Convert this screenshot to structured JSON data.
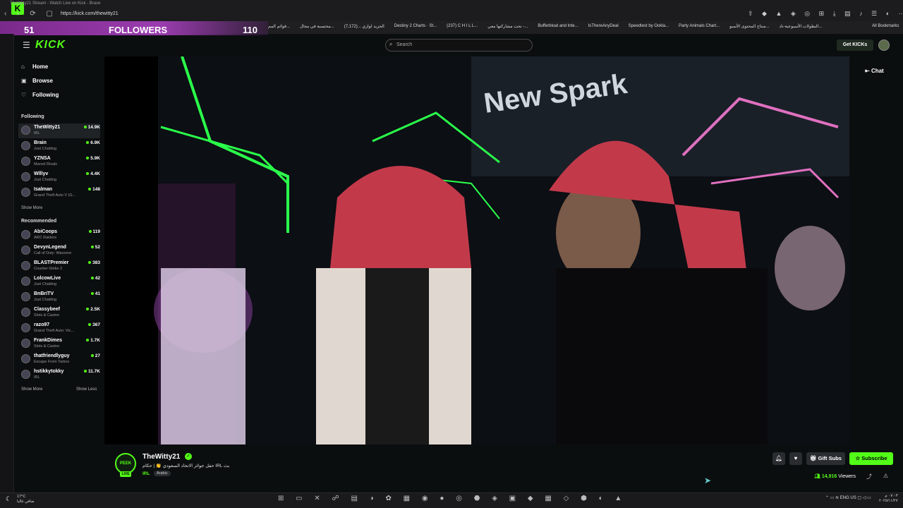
{
  "browser": {
    "tab_title": "TheWitty21 Stream - Watch Live on Kick - Brave",
    "url": "https://kick.com/thewitty21",
    "bookmarks": [
      "قوائم المم...",
      "محتسبة في مجال...",
      "الحزيد لوازي ...(7,172)",
      "Destiny 2 Charts · St...",
      "(237) C H I L L...",
      "نحت مشاركتها معي -...",
      "Bufferbloat and Inte...",
      "IsThereAnyDeal",
      "Speedtest by Ookla...",
      "Party Animals Chart...",
      "منتاج المحتوى الأسبو...",
      "البطولات الأسبوعية-ناد..."
    ],
    "all_bookmarks": "All Bookmarks"
  },
  "overlay": {
    "left_count": "51",
    "label": "FOLLOWERS",
    "right_count": "110"
  },
  "header": {
    "logo": "KICK",
    "search_placeholder": "Search",
    "get_kicks": "Get KICKs"
  },
  "sidebar": {
    "nav": [
      {
        "label": "Home",
        "icon": "home-icon"
      },
      {
        "label": "Browse",
        "icon": "browse-icon"
      },
      {
        "label": "Following",
        "icon": "heart-icon"
      }
    ],
    "following_title": "Following",
    "following": [
      {
        "name": "TheWitty21",
        "category": "IRL",
        "viewers": "14.9K"
      },
      {
        "name": "Brain",
        "category": "Just Chatting",
        "viewers": "6.9K"
      },
      {
        "name": "YZNSA",
        "category": "Marvel Rivals",
        "viewers": "5.9K"
      },
      {
        "name": "Wlllyv",
        "category": "Just Chatting",
        "viewers": "4.4K"
      },
      {
        "name": "Isalman",
        "category": "Grand Theft Auto V (G...",
        "viewers": "148"
      }
    ],
    "show_more": "Show More",
    "recommended_title": "Recommended",
    "recommended": [
      {
        "name": "AbiCoops",
        "category": "ARC Raiders",
        "viewers": "119"
      },
      {
        "name": "DevynLegend",
        "category": "Call of Duty: Warzone",
        "viewers": "52"
      },
      {
        "name": "BLASTPremier",
        "category": "Counter-Strike 2",
        "viewers": "383"
      },
      {
        "name": "LolcowLive",
        "category": "Just Chatting",
        "viewers": "42"
      },
      {
        "name": "BnBriTV",
        "category": "Just Chatting",
        "viewers": "41"
      },
      {
        "name": "Classybeef",
        "category": "Slots & Casino",
        "viewers": "2.5K"
      },
      {
        "name": "razo97",
        "category": "Grand Theft Auto: Vic...",
        "viewers": "367"
      },
      {
        "name": "FrankDimes",
        "category": "Slots & Casino",
        "viewers": "1.7K"
      },
      {
        "name": "thatfriendlyguy",
        "category": "Escape From Tarkov",
        "viewers": "27"
      },
      {
        "name": "hstikkytokky",
        "category": "IRL",
        "viewers": "11.7K"
      }
    ],
    "show_more_2": "Show More",
    "show_less": "Show Less"
  },
  "video": {
    "chat_label": "Chat",
    "sign_text": "New Spark"
  },
  "stream": {
    "name": "TheWitty21",
    "title": "حفل جوائز الاتحاد السعودي 👏 | حكام IRL بث",
    "category": "IRL",
    "tag": "Arabic",
    "live": "LIVE",
    "gift_subs": "Gift Subs",
    "subscribe": "Subscribe",
    "viewers_count": "14,916",
    "viewers_label": "Viewers"
  },
  "taskbar": {
    "temp": "17°C",
    "weather": "صافي غالبا",
    "lang": "ENG",
    "region": "US",
    "time": "٠٧:٠٣ م",
    "date": "٢٠٢٥/١١/٢٧"
  },
  "colors": {
    "accent": "#53fc18",
    "overlay_purple": "#9b3cb0"
  }
}
